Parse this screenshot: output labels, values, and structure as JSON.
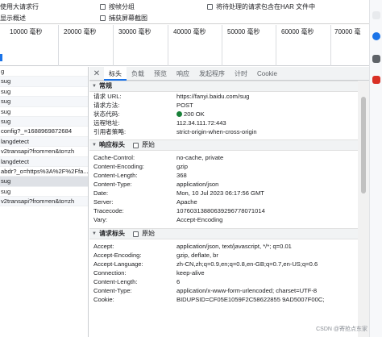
{
  "options": {
    "preserve_log": "使用大请求行",
    "overview": "显示概述",
    "group_by_frame": "按帧分组",
    "capture_screenshots": "捕获屏幕截图",
    "har_pending": "将待处理的请求包含在HAR 文件中"
  },
  "timeline": {
    "ticks": [
      "10000  毫秒",
      "20000  毫秒",
      "30000  毫秒",
      "40000  毫秒",
      "50000  毫秒",
      "60000  毫秒",
      "70000  毫"
    ]
  },
  "requests": [
    "g",
    "sug",
    "sug",
    "sug",
    "sug",
    "sug",
    "config?_=1688969872684",
    "langdetect",
    "v2transapi?from=en&to=zh",
    "langdetect",
    "abdr?_o=https%3A%2F%2Ffa...",
    "sug",
    "sug",
    "v2transapi?from=en&to=zh"
  ],
  "tabs": [
    "标头",
    "负载",
    "预览",
    "响应",
    "发起程序",
    "计时",
    "Cookie"
  ],
  "general": {
    "title": "常规",
    "rows": [
      {
        "k": "请求 URL:",
        "v": "https://fanyi.baidu.com/sug"
      },
      {
        "k": "请求方法:",
        "v": "POST"
      },
      {
        "k": "状态代码:",
        "v": "200 OK"
      },
      {
        "k": "远程地址:",
        "v": "112.34.111.72:443"
      },
      {
        "k": "引用者策略:",
        "v": "strict-origin-when-cross-origin"
      }
    ]
  },
  "response_headers": {
    "title": "响应标头",
    "raw": "原始",
    "rows": [
      {
        "k": "Cache-Control:",
        "v": "no-cache, private"
      },
      {
        "k": "Content-Encoding:",
        "v": "gzip"
      },
      {
        "k": "Content-Length:",
        "v": "368"
      },
      {
        "k": "Content-Type:",
        "v": "application/json"
      },
      {
        "k": "Date:",
        "v": "Mon, 10 Jul 2023 06:17:56 GMT"
      },
      {
        "k": "Server:",
        "v": "Apache"
      },
      {
        "k": "Tracecode:",
        "v": "10760313880639296778071014"
      },
      {
        "k": "Vary:",
        "v": "Accept-Encoding"
      }
    ]
  },
  "request_headers": {
    "title": "请求标头",
    "raw": "原始",
    "rows": [
      {
        "k": "Accept:",
        "v": "application/json, text/javascript, */*; q=0.01"
      },
      {
        "k": "Accept-Encoding:",
        "v": "gzip, deflate, br"
      },
      {
        "k": "Accept-Language:",
        "v": "zh-CN,zh;q=0.9,en;q=0.8,en-GB;q=0.7,en-US;q=0.6"
      },
      {
        "k": "Connection:",
        "v": "keep-alive"
      },
      {
        "k": "Content-Length:",
        "v": "6"
      },
      {
        "k": "Content-Type:",
        "v": "application/x-www-form-urlencoded; charset=UTF-8"
      },
      {
        "k": "Cookie:",
        "v": "BIDUPSID=CF05E1059F2C58622855 9AD5007F00C;"
      }
    ]
  },
  "watermark": "CSDN @寄抢点东家",
  "colors": {
    "accent": "#1a73e8",
    "status_ok": "#188038"
  }
}
